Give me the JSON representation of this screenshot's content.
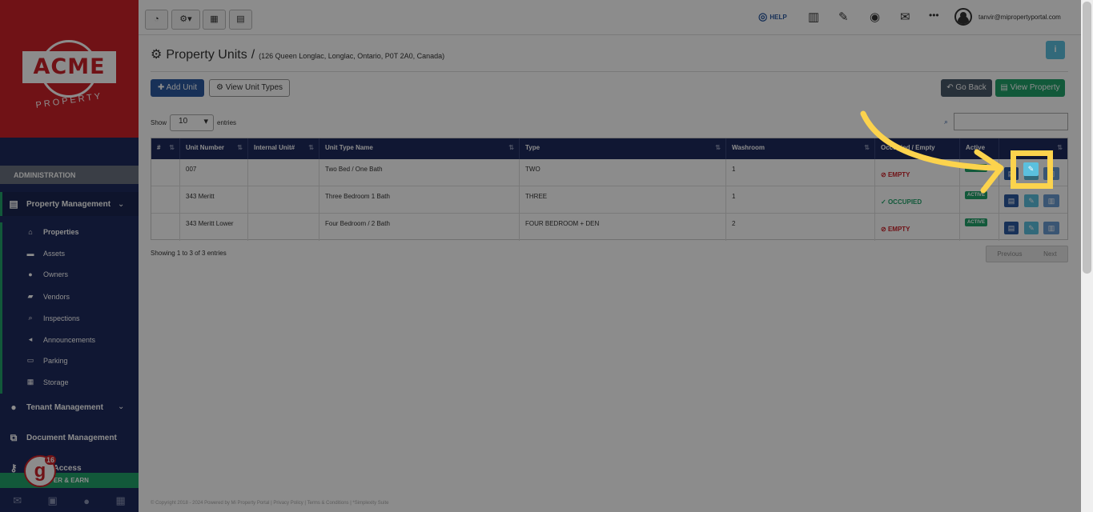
{
  "sidebar": {
    "logo_text": "ACME",
    "logo_subtext": "PROPERTY",
    "section_header": "ADMINISTRATION",
    "property_management": "Property Management",
    "submenu": [
      {
        "label": "Properties",
        "icon": "home-icon"
      },
      {
        "label": "Assets",
        "icon": "list-icon"
      },
      {
        "label": "Owners",
        "icon": "user-icon"
      },
      {
        "label": "Vendors",
        "icon": "briefcase-icon"
      },
      {
        "label": "Inspections",
        "icon": "search-icon"
      },
      {
        "label": "Announcements",
        "icon": "megaphone-icon"
      },
      {
        "label": "Parking",
        "icon": "car-icon"
      },
      {
        "label": "Storage",
        "icon": "archive-icon"
      }
    ],
    "tenant_management": "Tenant Management",
    "document_management": "Document Management",
    "admin_access": "Admin Access",
    "refer_label": "FER & EARN",
    "badge_letter": "g",
    "badge_count": "16"
  },
  "topbar": {
    "help_label": "HELP",
    "user_email": "tanvir@mipropertyportal.com"
  },
  "page": {
    "title": "Property Units",
    "separator": "/",
    "address": "(126 Queen Longlac, Longlac, Ontario, P0T 2A0, Canada)",
    "info_label": "i"
  },
  "actions": {
    "add_unit": "Add Unit",
    "view_unit_types": "View Unit Types",
    "go_back": "Go Back",
    "view_property": "View Property"
  },
  "table_controls": {
    "show_label": "Show",
    "page_size": "10",
    "entries_label": "entries"
  },
  "table": {
    "headers": [
      "#",
      "Unit Number",
      "Internal Unit#",
      "Unit Type Name",
      "Type",
      "Washroom",
      "Occupied / Empty",
      "Active",
      ""
    ],
    "rows": [
      {
        "num": "",
        "unit_number": "007",
        "internal": "",
        "type_name": "Two Bed / One Bath",
        "type": "TWO",
        "washroom": "1",
        "status": "EMPTY",
        "active": "ACTIVE"
      },
      {
        "num": "",
        "unit_number": "343 Meritt",
        "internal": "",
        "type_name": "Three Bedroom 1 Bath",
        "type": "THREE",
        "washroom": "1",
        "status": "OCCUPIED",
        "active": "ACTIVE"
      },
      {
        "num": "",
        "unit_number": "343 Meritt Lower",
        "internal": "",
        "type_name": "Four Bedroom / 2 Bath",
        "type": "FOUR BEDROOM + DEN",
        "washroom": "2",
        "status": "EMPTY",
        "active": "ACTIVE"
      }
    ],
    "info": "Showing 1 to 3 of 3 entries",
    "previous": "Previous",
    "next": "Next"
  },
  "footer": {
    "text": "© Copyright 2018 - 2024 Powered by Mi Property Portal | Privacy Policy | Terms & Conditions | *Simplexity Suite"
  },
  "colors": {
    "sidebar": "#1e2a5e",
    "brand_red": "#cc2229",
    "accent_green": "#22a36b",
    "highlight_yellow": "#fcd34d"
  }
}
